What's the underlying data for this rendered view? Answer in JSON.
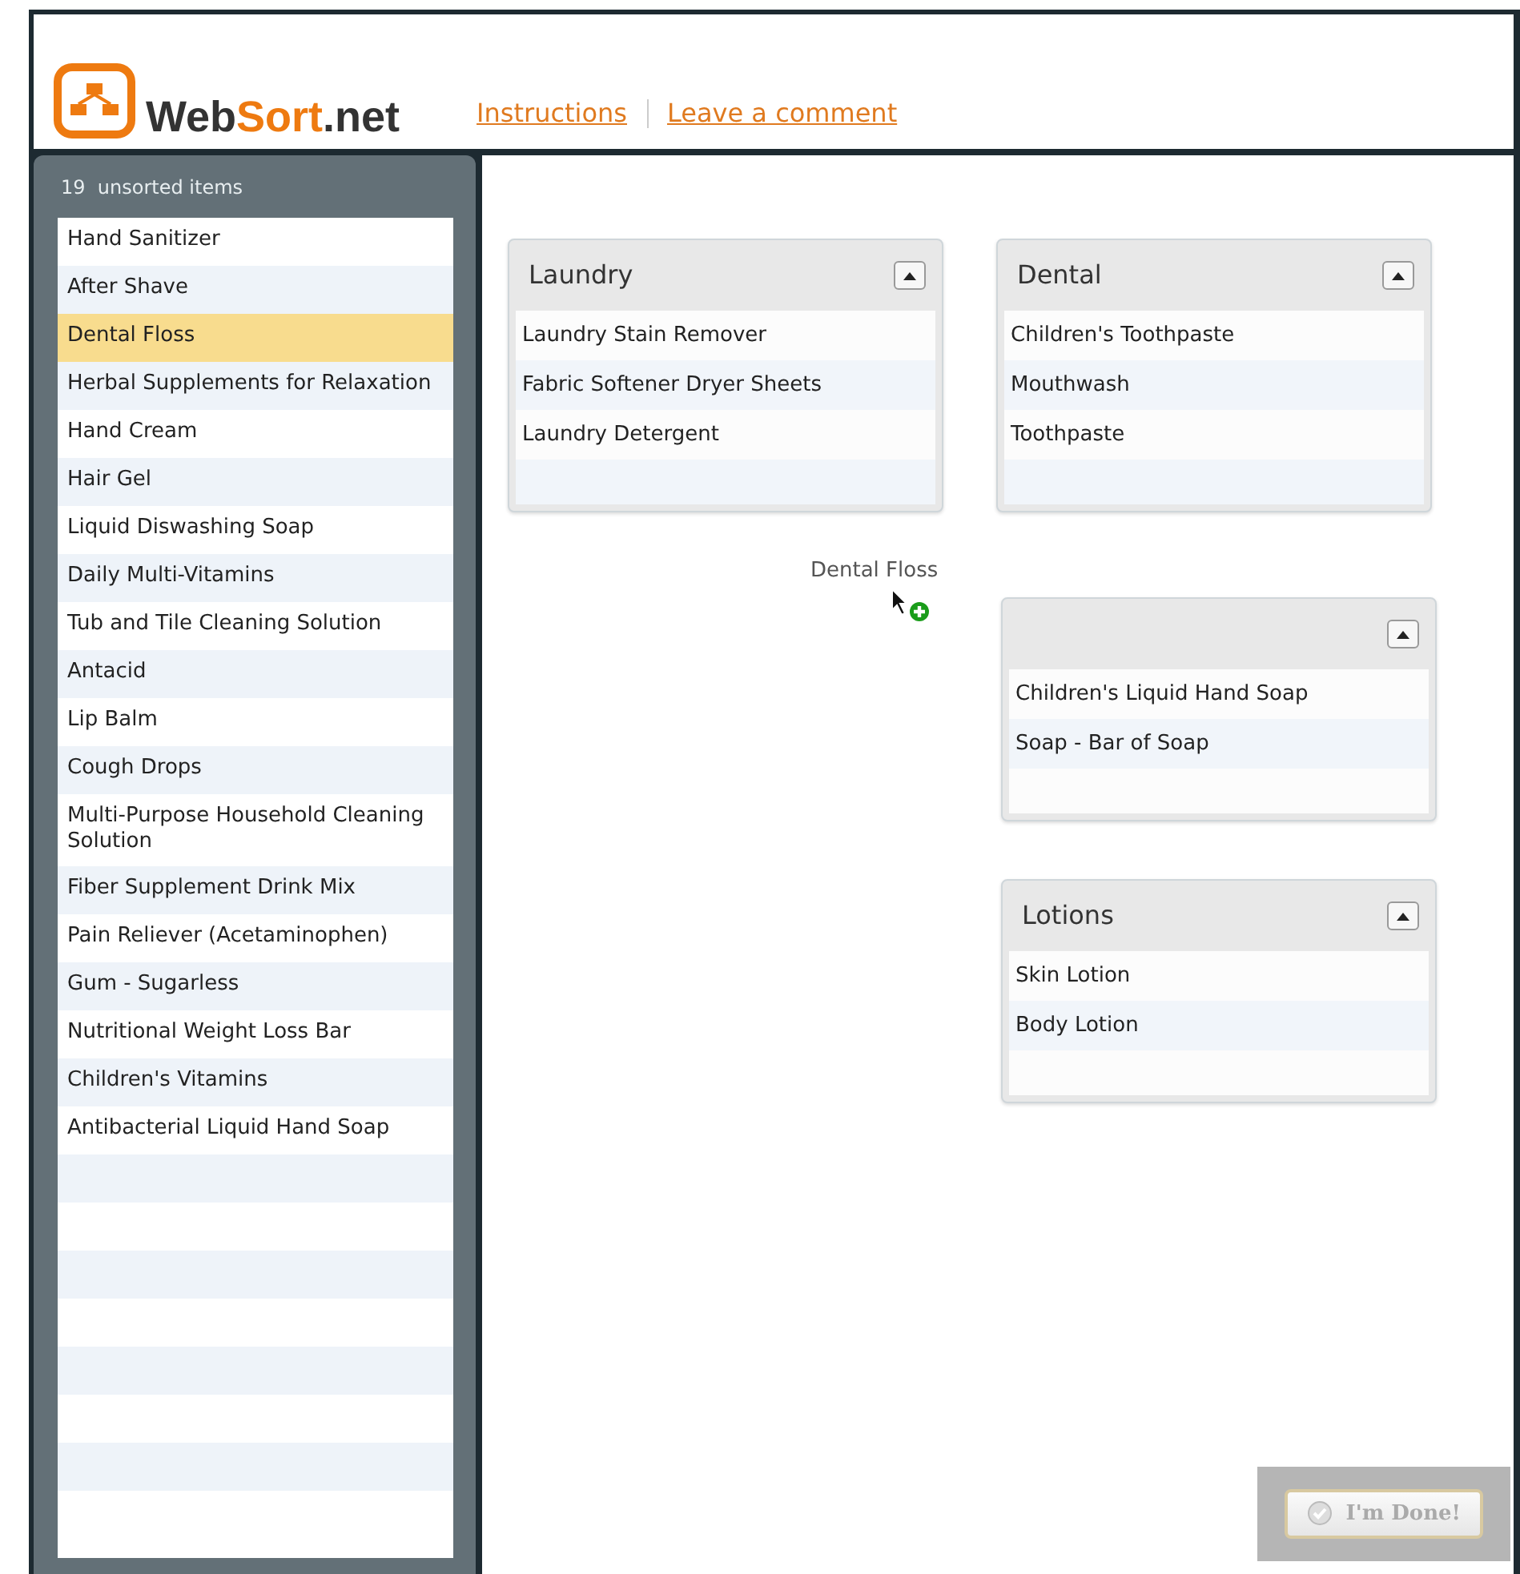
{
  "header": {
    "logo": {
      "prefix": "Web",
      "accent": "Sort",
      "suffix": ".net"
    },
    "links": [
      "Instructions",
      "Leave a comment"
    ]
  },
  "sidebar": {
    "count": "19",
    "label": "unsorted items",
    "items": [
      {
        "label": "Hand Sanitizer",
        "selected": false
      },
      {
        "label": "After Shave",
        "selected": false
      },
      {
        "label": "Dental Floss",
        "selected": true
      },
      {
        "label": "Herbal Supplements for Relaxation",
        "selected": false
      },
      {
        "label": "Hand Cream",
        "selected": false
      },
      {
        "label": "Hair Gel",
        "selected": false
      },
      {
        "label": "Liquid Diswashing Soap",
        "selected": false
      },
      {
        "label": "Daily Multi-Vitamins",
        "selected": false
      },
      {
        "label": "Tub and Tile Cleaning Solution",
        "selected": false
      },
      {
        "label": "Antacid",
        "selected": false
      },
      {
        "label": "Lip Balm",
        "selected": false
      },
      {
        "label": "Cough Drops",
        "selected": false
      },
      {
        "label": "Multi-Purpose Household Cleaning Solution",
        "selected": false
      },
      {
        "label": "Fiber Supplement Drink Mix",
        "selected": false
      },
      {
        "label": "Pain Reliever (Acetaminophen)",
        "selected": false
      },
      {
        "label": "Gum - Sugarless",
        "selected": false
      },
      {
        "label": "Nutritional Weight Loss Bar",
        "selected": false
      },
      {
        "label": "Children's Vitamins",
        "selected": false
      },
      {
        "label": "Antibacterial Liquid Hand Soap",
        "selected": false
      }
    ]
  },
  "groups": [
    {
      "title": "Laundry",
      "items": [
        "Laundry Stain Remover",
        "Fabric Softener Dryer Sheets",
        "Laundry Detergent"
      ]
    },
    {
      "title": "Dental",
      "items": [
        "Children's Toothpaste",
        "Mouthwash",
        "Toothpaste"
      ]
    },
    {
      "items": [
        "Children's Liquid Hand Soap",
        "Soap - Bar of Soap"
      ]
    },
    {
      "title": "Lotions",
      "items": [
        "Skin Lotion",
        "Body Lotion"
      ]
    }
  ],
  "drag_item": {
    "label": "Dental Floss"
  },
  "done_button": {
    "label": "I'm Done!",
    "disabled": true
  }
}
